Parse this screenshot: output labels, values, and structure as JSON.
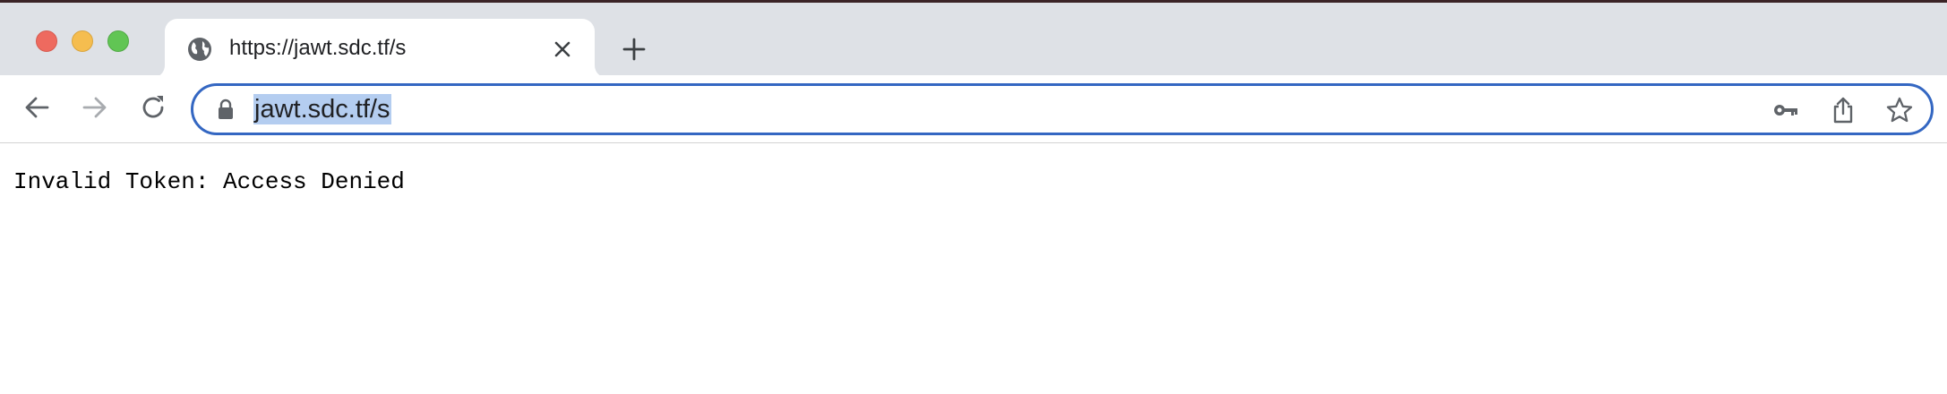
{
  "window": {
    "controls": [
      "close",
      "minimize",
      "maximize"
    ]
  },
  "tab": {
    "title": "https://jawt.sdc.tf/s",
    "favicon": "globe-icon",
    "close_icon": "close-icon"
  },
  "new_tab_icon": "plus-icon",
  "toolbar": {
    "back_icon": "arrow-left-icon",
    "forward_icon": "arrow-right-icon",
    "reload_icon": "reload-icon"
  },
  "omnibox": {
    "url": "jawt.sdc.tf/s",
    "lock_icon": "lock-icon",
    "right_icons": [
      "key-icon",
      "share-icon",
      "star-icon"
    ]
  },
  "page": {
    "message": "Invalid Token: Access Denied"
  },
  "colors": {
    "focus_ring": "#3467c2",
    "selection": "#b4cdf0",
    "tabstrip": "#dee1e6"
  }
}
